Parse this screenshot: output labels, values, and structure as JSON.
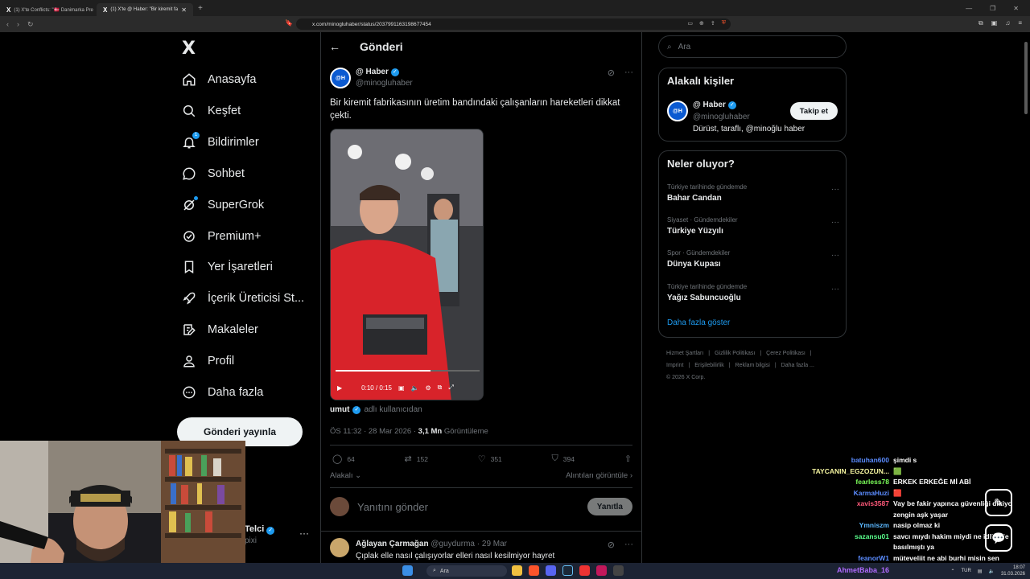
{
  "browser": {
    "tabs": [
      {
        "label": "(1) X'te Conflicts: \"🇩🇰 Danimarka Pre",
        "active": false
      },
      {
        "label": "(1) X'te @ Haber: \"Bir kiremit fa",
        "active": true
      }
    ],
    "new_tab": "+",
    "url": "x.com/minogluhaber/status/2037991163198677454"
  },
  "nav": {
    "logo": "X",
    "items": [
      {
        "label": "Anasayfa",
        "icon": "home-icon"
      },
      {
        "label": "Keşfet",
        "icon": "search-icon"
      },
      {
        "label": "Bildirimler",
        "icon": "bell-icon",
        "badge": "1"
      },
      {
        "label": "Sohbet",
        "icon": "chat-icon"
      },
      {
        "label": "SuperGrok",
        "icon": "grok-icon"
      },
      {
        "label": "Premium+",
        "icon": "premium-icon"
      },
      {
        "label": "Yer İşaretleri",
        "icon": "bookmark-icon"
      },
      {
        "label": "İçerik Üreticisi St...",
        "icon": "rocket-icon"
      },
      {
        "label": "Makaleler",
        "icon": "article-icon"
      },
      {
        "label": "Profil",
        "icon": "profile-icon"
      },
      {
        "label": "Daha fazla",
        "icon": "more-circle-icon"
      }
    ],
    "post_button": "Gönderi yayınla",
    "account_name": "Telci",
    "account_handle": "pixi"
  },
  "main": {
    "header_title": "Gönderi",
    "tweet": {
      "avatar_text": "@H",
      "author_name": "@ Haber",
      "author_handle": "@minogluhaber",
      "text": "Bir kiremit fabrikasının üretim bandındaki çalışanların hareketleri dikkat çekti.",
      "video_time": "0:10 / 0:15",
      "video_progress": 0.66,
      "credit_user": "umut",
      "credit_suffix": "adlı kullanıcıdan",
      "time": "ÖS 11:32 · 28 Mar 2026 · ",
      "views": "3,1 Mn",
      "views_label": " Görüntüleme",
      "replies": "64",
      "reposts": "152",
      "likes": "351",
      "bookmarks": "394",
      "relevant": "Alakalı",
      "quotes": "Alıntıları görüntüle"
    },
    "reply_placeholder": "Yanıtını gönder",
    "reply_button": "Yanıtla",
    "reply": {
      "name": "Ağlayan Çarmağan",
      "handle": "@guydurma · 29 Mar",
      "text": "Çıplak elle nasıl çalışıyorlar elleri nasıl kesilmiyor hayret"
    }
  },
  "right": {
    "search_placeholder": "Ara",
    "related_title": "Alakalı kişiler",
    "related": {
      "avatar_text": "@H",
      "name": "@ Haber",
      "handle": "@minogluhaber",
      "bio": "Dürüst, taraflı, @minoğlu haber",
      "follow": "Takip et"
    },
    "trends_title": "Neler oluyor?",
    "trends": [
      {
        "category": "Türkiye tarihinde gündemde",
        "name": "Bahar Candan"
      },
      {
        "category": "Siyaset · Gündemdekiler",
        "name": "Türkiye Yüzyılı"
      },
      {
        "category": "Spor · Gündemdekiler",
        "name": "Dünya Kupası"
      },
      {
        "category": "Türkiye tarihinde gündemde",
        "name": "Yağız Sabuncuoğlu"
      }
    ],
    "show_more": "Daha fazla göster",
    "footer": [
      "Hizmet Şartları",
      "|",
      "Gizlilik Politikası",
      "|",
      "Çerez Politikası",
      "|",
      "Imprint",
      "|",
      "Erişilebilirlik",
      "|",
      "Reklam bilgisi",
      "|",
      "Daha fazla ...",
      "© 2026 X Corp."
    ]
  },
  "chat": [
    {
      "user": "batuhan600",
      "color": "#5b8cff",
      "msg": "şimdi s"
    },
    {
      "user": "TAYCANIN_EGZOZUN...",
      "color": "#f5f5a0",
      "msg": "🟩"
    },
    {
      "user": "fearless78",
      "color": "#7cff5a",
      "msg": "ERKEK ERKEĞE Mİ ABİ"
    },
    {
      "user": "KarmaHuzi",
      "color": "#5b8cff",
      "msg": "🟥"
    },
    {
      "user": "xavis3587",
      "color": "#ff5a7a",
      "msg": "Vay be fakir yapınca güvenliği dikiyo zengin aşk yaşar"
    },
    {
      "user": "Ymniszm",
      "color": "#5bb8ff",
      "msg": "nasip olmaz ki"
    },
    {
      "user": "sazansu01",
      "color": "#5aff8c",
      "msg": "savcı mıydı hakim miydi ne idliyede basılmıştı ya"
    },
    {
      "user": "feanorW1",
      "color": "#5b8cff",
      "msg": "müteveliit ne abi burhi misin sen"
    }
  ],
  "taskbar": {
    "search": "Ara",
    "user": "AhmetBaba_16",
    "lang": "TUR",
    "time": "18:07",
    "date": "31.03.2026"
  }
}
